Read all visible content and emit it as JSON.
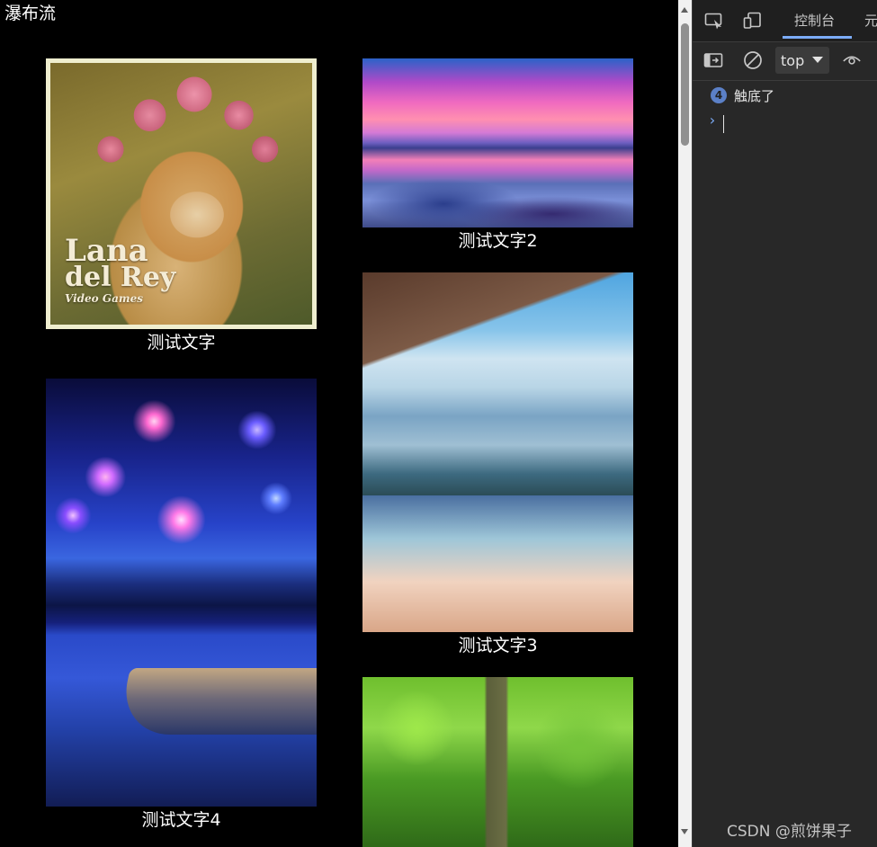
{
  "page": {
    "title": "瀑布流"
  },
  "cards": [
    {
      "caption": "测试文字",
      "image": "doge-flower-crown-image"
    },
    {
      "caption": "测试文字2",
      "image": "sunset-lake-image"
    },
    {
      "caption": "测试文字3",
      "image": "mountain-lake-image"
    },
    {
      "caption": "测试文字4",
      "image": "fireworks-boat-image"
    },
    {
      "caption": "",
      "image": "green-forest-image"
    }
  ],
  "doge_art_text": {
    "line1": "Lana",
    "line2": "del Rey",
    "line3": "Video Games"
  },
  "devtools": {
    "tabs": [
      "控制台",
      "元"
    ],
    "active_tab": "控制台",
    "context": "top",
    "messages": [
      {
        "count": "4",
        "text": "触底了"
      }
    ],
    "icons": [
      "inspect-element-icon",
      "device-toolbar-icon",
      "sidebar-toggle-icon",
      "clear-console-icon",
      "live-expression-eye-icon"
    ]
  },
  "watermark": "CSDN @煎饼果子"
}
